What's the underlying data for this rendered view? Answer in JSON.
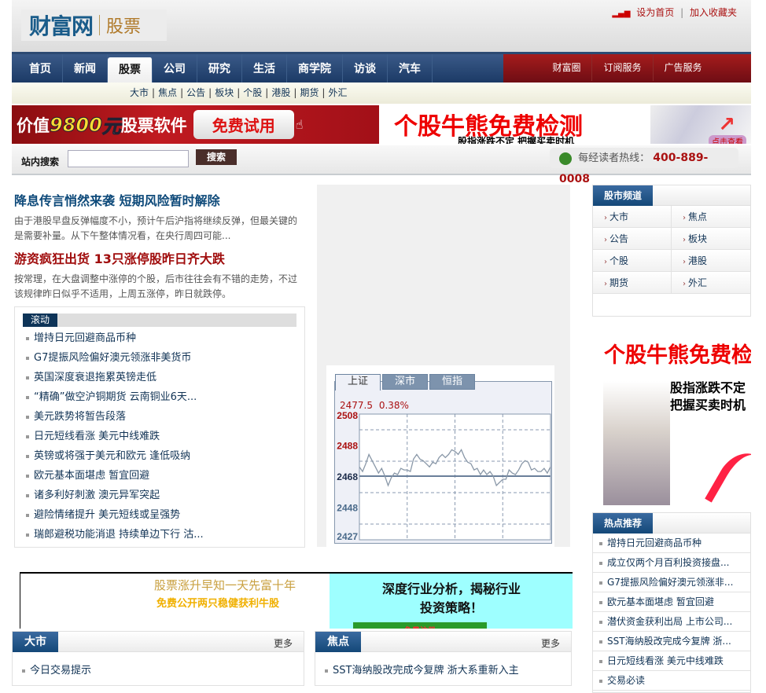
{
  "header": {
    "logo_main": "财富网",
    "logo_sub": "股票",
    "set_home": "设为首页",
    "separator": "|",
    "add_favorite": "加入收藏夹"
  },
  "nav": {
    "items": [
      "首页",
      "新闻",
      "股票",
      "公司",
      "研究",
      "生活",
      "商学院",
      "访谈",
      "汽车"
    ],
    "active": "股票",
    "right_items": [
      "财富圈",
      "订阅服务",
      "广告服务"
    ]
  },
  "subnav": {
    "items": [
      "大市",
      "焦点",
      "公告",
      "板块",
      "个股",
      "港股",
      "期货",
      "外汇"
    ]
  },
  "ad_banner_left": {
    "text1": "价值",
    "number": "9800",
    "unit": "元",
    "text2": "股票软件",
    "button": "免费试用"
  },
  "ad_banner_right": {
    "title": "个股牛熊免费检测",
    "subtitle": "股指涨跌不定  把握买卖时机",
    "badge": "点击查看"
  },
  "search": {
    "label": "站内搜索",
    "value": "",
    "placeholder": "",
    "button": "搜索"
  },
  "hotline": {
    "label": "每经读者热线：",
    "number": "400-889-0008"
  },
  "lead": [
    {
      "title": "降息传言悄然来袭  短期风险暂时解除",
      "summary": "由于港股早盘反弹幅度不小，预计午后沪指将继续反弹，但最关键的是需要补量。从下午整体情况看，在央行周四可能..."
    },
    {
      "title": "游资疯狂出货  13只涨停股昨日齐大跌",
      "summary": "按常理，在大盘调整中涨停的个股，后市往往会有不错的走势，不过该规律昨日似乎不适用，上周五涨停，昨日就跌停。"
    }
  ],
  "scroll_news": {
    "label": "滚动",
    "items": [
      "增持日元回避商品币种",
      "G7提振风险偏好澳元领涨非美货币",
      "英国深度衰退拖累英镑走低",
      "“精确”做空沪铜期货  云南铜业6天...",
      "美元跌势将暂告段落",
      "日元短线看涨  美元中线难跌",
      "英镑或将强于美元和欧元  逢低吸纳",
      "欧元基本面堪虑  暂宜回避",
      "诸多利好刺激  澳元异军突起",
      "避险情绪提升  美元短线或呈强势",
      "瑞郎避税功能消退  持续单边下行  沽..."
    ]
  },
  "index_widget": {
    "tabs": [
      "上证",
      "深市",
      "恒指"
    ],
    "active_tab": "上证",
    "price": "2477.5",
    "change": "0.38%"
  },
  "chart_data": {
    "type": "line",
    "title": "上证",
    "yticks": [
      2508,
      2488,
      2468,
      2448,
      2427
    ],
    "ylim": [
      2427,
      2508
    ],
    "baseline": 2468,
    "grid": true,
    "values": [
      2474,
      2471,
      2476,
      2482,
      2478,
      2474,
      2470,
      2473,
      2468,
      2462,
      2467,
      2470,
      2469,
      2473,
      2472,
      2472,
      2471,
      2479,
      2482,
      2479,
      2478,
      2476,
      2474,
      2477,
      2476,
      2480,
      2482,
      2480,
      2482,
      2485,
      2484,
      2482,
      2485,
      2480,
      2477,
      2476,
      2472,
      2473,
      2469,
      2472,
      2469,
      2471,
      2468,
      2462,
      2464,
      2466,
      2466,
      2472,
      2470,
      2469,
      2472,
      2476,
      2478,
      2477,
      2472,
      2473,
      2471,
      2471,
      2473,
      2470,
      2474
    ]
  },
  "ad_text": {
    "line1": "股票涨升早知一天先富十年",
    "line2": "免费公开两只稳健获利牛股",
    "cyan_text": "深度行业分析，揭秘行业投资策略！",
    "cyan_button": "免费注册"
  },
  "box_dashi": {
    "title": "大市",
    "more": "更多",
    "items": [
      "今日交易提示"
    ]
  },
  "box_jiaodian": {
    "title": "焦点",
    "more": "更多",
    "items": [
      "SST海纳股改完成今复牌  浙大系重新入主"
    ]
  },
  "channel": {
    "title": "股市频道",
    "items": [
      "大市",
      "焦点",
      "公告",
      "板块",
      "个股",
      "港股",
      "期货",
      "外汇"
    ]
  },
  "ad_side": {
    "title": "个股牛熊免费检测",
    "line1": "股指涨跌不定",
    "line2": "把握买卖时机"
  },
  "hot": {
    "title": "热点推荐",
    "items": [
      "增持日元回避商品币种",
      "成立仅两个月百利投资接盘...",
      "G7提振风险偏好澳元领涨非...",
      "欧元基本面堪虑  暂宜回避",
      "潜伏资金获利出局  上市公司...",
      "SST海纳股改完成今复牌  浙...",
      "日元短线看涨  美元中线难跌",
      "交易必读"
    ]
  },
  "colors": {
    "nav_blue": "#1c3a66",
    "nav_red": "#a51c1c",
    "link": "#113355",
    "lead_blue": "#0e4a7a",
    "lead_red": "#a00d0d"
  }
}
